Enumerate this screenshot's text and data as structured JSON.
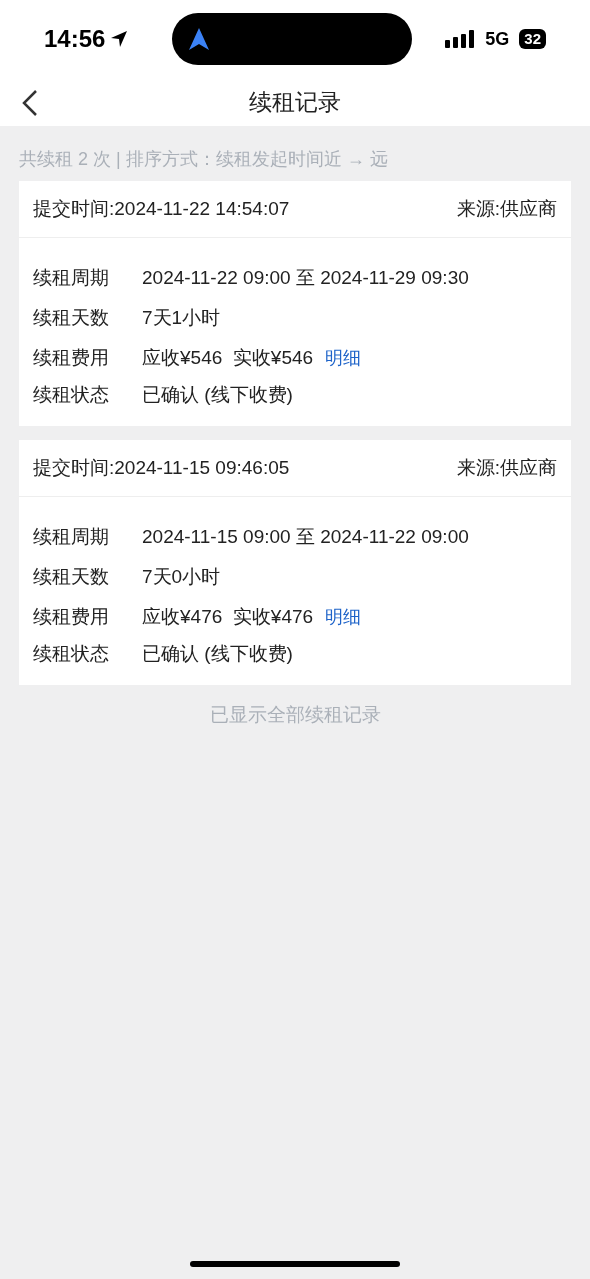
{
  "status_bar": {
    "time": "14:56",
    "network": "5G",
    "battery": "32"
  },
  "nav": {
    "title": "续租记录"
  },
  "summary": "共续租 2 次 | 排序方式：续租发起时间近 → 远",
  "records": [
    {
      "submitted": "提交时间:2024-11-22 14:54:07",
      "source": "来源:供应商",
      "fields": [
        {
          "label": "续租周期",
          "value": "2024-11-22 09:00 至 2024-11-29 09:30"
        },
        {
          "label": "续租天数",
          "value": "7天1小时"
        },
        {
          "label": "续租费用",
          "value": "应收¥546  实收¥546",
          "link": "明细"
        },
        {
          "label": "续租状态",
          "value": "已确认 (线下收费)"
        }
      ]
    },
    {
      "submitted": "提交时间:2024-11-15 09:46:05",
      "source": "来源:供应商",
      "fields": [
        {
          "label": "续租周期",
          "value": "2024-11-15 09:00 至 2024-11-22 09:00"
        },
        {
          "label": "续租天数",
          "value": "7天0小时"
        },
        {
          "label": "续租费用",
          "value": "应收¥476  实收¥476",
          "link": "明细"
        },
        {
          "label": "续租状态",
          "value": "已确认 (线下收费)"
        }
      ]
    }
  ],
  "footer": "已显示全部续租记录"
}
